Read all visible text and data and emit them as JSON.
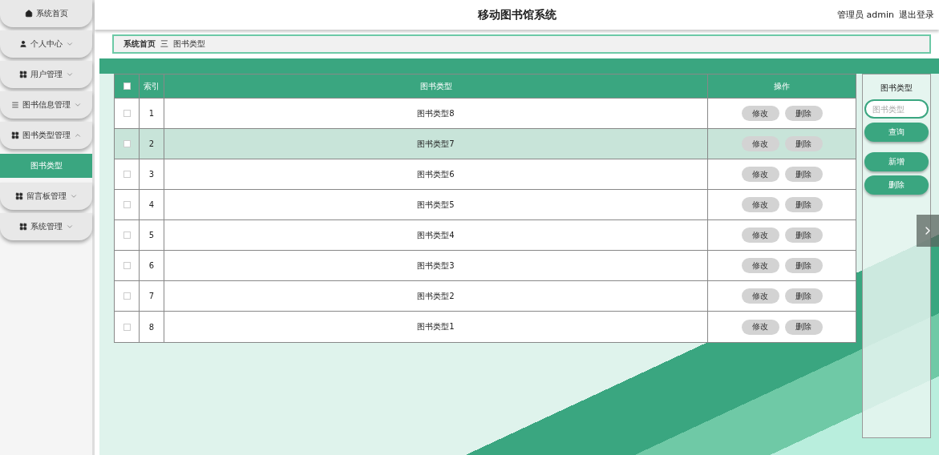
{
  "sidebar": {
    "items": [
      {
        "label": "系统首页"
      },
      {
        "label": "个人中心",
        "expanded": false
      },
      {
        "label": "用户管理",
        "expanded": false
      },
      {
        "label": "图书信息管理",
        "expanded": false
      },
      {
        "label": "图书类型管理",
        "expanded": true,
        "children": [
          {
            "label": "图书类型",
            "selected": true
          }
        ]
      },
      {
        "label": "留言板管理",
        "expanded": false
      },
      {
        "label": "系统管理",
        "expanded": false
      }
    ]
  },
  "header": {
    "title": "移动图书馆系统",
    "user": "管理员 admin",
    "logout": "退出登录"
  },
  "breadcrumb": {
    "home": "系统首页",
    "separator": "三",
    "current": "图书类型"
  },
  "table": {
    "all_checked": false,
    "columns": [
      "索引",
      "图书类型",
      "操作"
    ],
    "rows": [
      {
        "index": "1",
        "type": "图书类型8",
        "checked": false,
        "highlighted": false,
        "actions": [
          "修改",
          "删除"
        ]
      },
      {
        "index": "2",
        "type": "图书类型7",
        "checked": false,
        "highlighted": true,
        "actions": [
          "修改",
          "删除"
        ]
      },
      {
        "index": "3",
        "type": "图书类型6",
        "checked": false,
        "highlighted": false,
        "actions": [
          "修改",
          "删除"
        ]
      },
      {
        "index": "4",
        "type": "图书类型5",
        "checked": false,
        "highlighted": false,
        "actions": [
          "修改",
          "删除"
        ]
      },
      {
        "index": "5",
        "type": "图书类型4",
        "checked": false,
        "highlighted": false,
        "actions": [
          "修改",
          "删除"
        ]
      },
      {
        "index": "6",
        "type": "图书类型3",
        "checked": false,
        "highlighted": false,
        "actions": [
          "修改",
          "删除"
        ]
      },
      {
        "index": "7",
        "type": "图书类型2",
        "checked": false,
        "highlighted": false,
        "actions": [
          "修改",
          "删除"
        ]
      },
      {
        "index": "8",
        "type": "图书类型1",
        "checked": false,
        "highlighted": false,
        "actions": [
          "修改",
          "删除"
        ]
      }
    ]
  },
  "search_panel": {
    "title": "图书类型",
    "placeholder": "图书类型",
    "search_button": "查询",
    "buttons": [
      "新增",
      "删除"
    ]
  }
}
